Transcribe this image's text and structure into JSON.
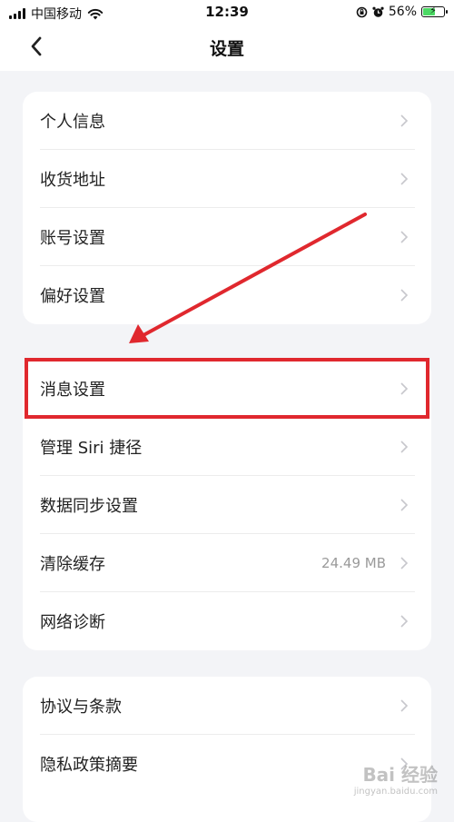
{
  "status_bar": {
    "carrier": "中国移动",
    "time": "12:39",
    "battery": "56%",
    "battery_level": 0.56,
    "icons": [
      "signal-icon",
      "wifi-icon",
      "orientation-lock-icon",
      "alarm-icon",
      "battery-icon"
    ]
  },
  "nav": {
    "title": "设置",
    "back_icon": "chevron-left-icon"
  },
  "sections": [
    {
      "items": [
        {
          "label": "个人信息"
        },
        {
          "label": "收货地址"
        },
        {
          "label": "账号设置"
        },
        {
          "label": "偏好设置"
        }
      ]
    },
    {
      "items": [
        {
          "label": "消息设置"
        },
        {
          "label": "管理 Siri 捷径"
        },
        {
          "label": "数据同步设置"
        },
        {
          "label": "清除缓存",
          "value": "24.49 MB"
        },
        {
          "label": "网络诊断"
        }
      ]
    },
    {
      "items": [
        {
          "label": "协议与条款"
        },
        {
          "label": "隐私政策摘要"
        }
      ]
    }
  ],
  "annotation": {
    "color": "#e0282e",
    "highlighted_item": "消息设置"
  },
  "watermark": {
    "text": "Bai 经验",
    "url": "jingyan.baidu.com"
  }
}
